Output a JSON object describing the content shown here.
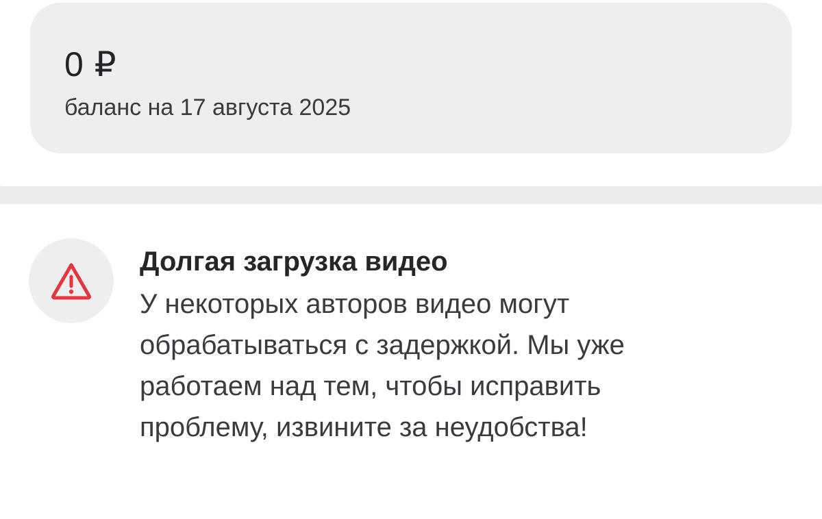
{
  "balance": {
    "amount": "0 ₽",
    "date_label": "баланс на 17 августа 2025"
  },
  "notice": {
    "icon": "warning-icon",
    "icon_color": "#e5363b",
    "title": "Долгая загрузка видео",
    "body_lines": [
      "У некоторых авторов видео могут",
      "обрабатываться с задержкой. Мы уже",
      "работаем над тем, чтобы исправить",
      "проблему, извините за неудобства!"
    ]
  }
}
